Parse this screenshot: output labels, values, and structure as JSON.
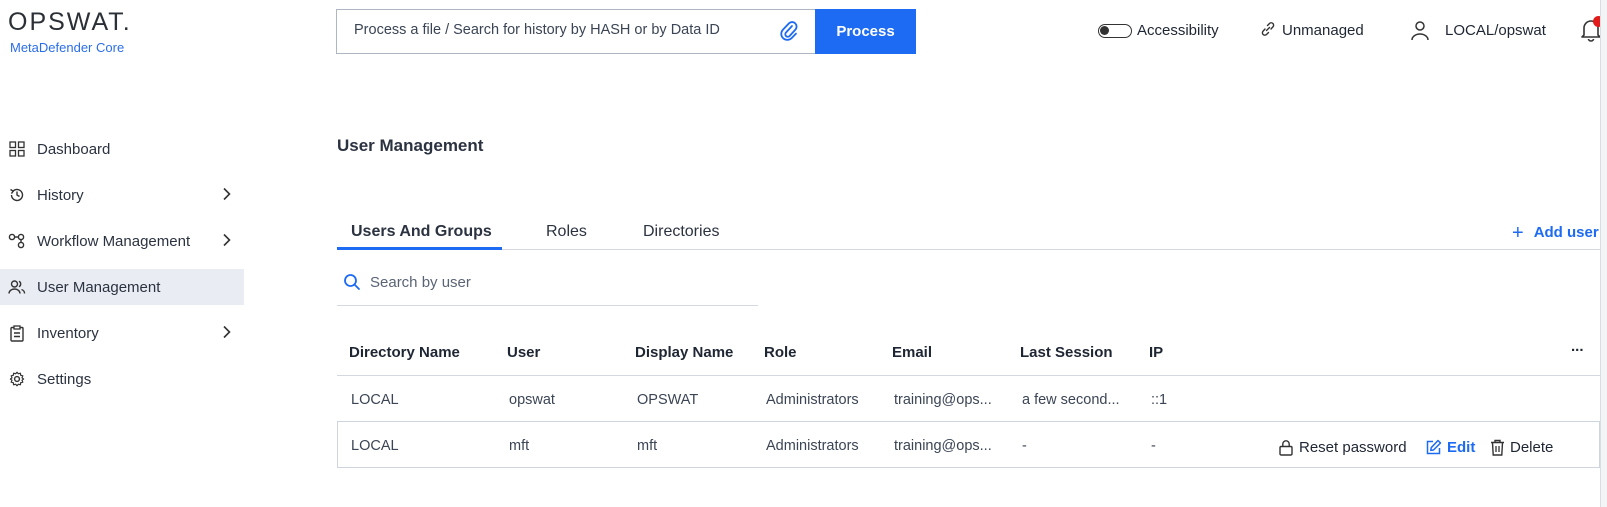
{
  "brand": {
    "name": "OPSWAT.",
    "product": "MetaDefender Core"
  },
  "search": {
    "placeholder": "Process a file / Search for history by HASH or by Data ID",
    "process_label": "Process"
  },
  "topbar": {
    "accessibility_label": "Accessibility",
    "unmanaged_label": "Unmanaged",
    "user_label": "LOCAL/opswat"
  },
  "sidebar": {
    "items": [
      {
        "label": "Dashboard",
        "icon": "grid-icon"
      },
      {
        "label": "History",
        "icon": "history-icon"
      },
      {
        "label": "Workflow Management",
        "icon": "workflow-icon"
      },
      {
        "label": "User Management",
        "icon": "users-icon"
      },
      {
        "label": "Inventory",
        "icon": "clipboard-icon"
      },
      {
        "label": "Settings",
        "icon": "gear-icon"
      }
    ]
  },
  "main": {
    "title": "User Management",
    "tabs": [
      {
        "label": "Users And Groups"
      },
      {
        "label": "Roles"
      },
      {
        "label": "Directories"
      }
    ],
    "add_user_label": "Add user",
    "search_placeholder": "Search by user",
    "table": {
      "columns": [
        "Directory Name",
        "User",
        "Display Name",
        "Role",
        "Email",
        "Last Session",
        "IP"
      ],
      "more_label": "...",
      "rows": [
        {
          "directory": "LOCAL",
          "user": "opswat",
          "display": "OPSWAT",
          "role": "Administrators",
          "email": "training@ops...",
          "session": "a few second...",
          "ip": "::1"
        },
        {
          "directory": "LOCAL",
          "user": "mft",
          "display": "mft",
          "role": "Administrators",
          "email": "training@ops...",
          "session": "-",
          "ip": "-"
        }
      ],
      "row_actions": {
        "reset_password": "Reset password",
        "edit": "Edit",
        "delete": "Delete"
      }
    }
  },
  "colors": {
    "accent": "#1d6bf3",
    "active_nav_bg": "#e9edf3",
    "notification_dot": "#e21b1b"
  }
}
